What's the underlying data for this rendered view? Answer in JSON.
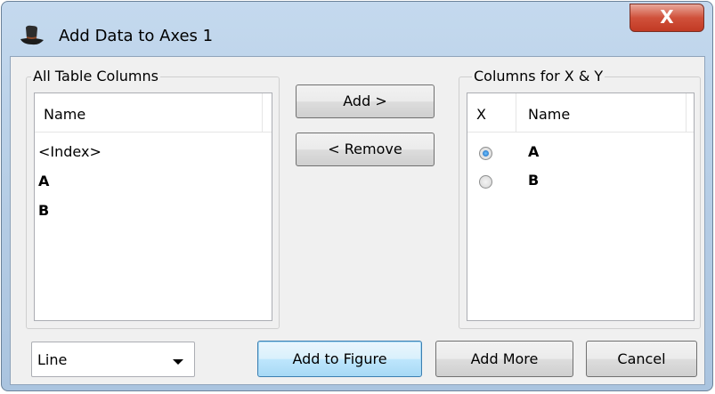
{
  "window": {
    "title": "Add Data to Axes 1",
    "close_glyph": "X",
    "app_icon": "top-hat-icon"
  },
  "all_columns": {
    "group_title": "All Table Columns",
    "header": "Name",
    "items": [
      "<Index>",
      "A",
      "B"
    ]
  },
  "buttons": {
    "add": "Add >",
    "remove": "< Remove",
    "add_to_figure": "Add to Figure",
    "add_more": "Add More",
    "cancel": "Cancel"
  },
  "xy_columns": {
    "group_title": "Columns for X & Y",
    "header_x": "X",
    "header_name": "Name",
    "rows": [
      {
        "name": "A",
        "is_x": true
      },
      {
        "name": "B",
        "is_x": false
      }
    ]
  },
  "plot_type": {
    "selected": "Line"
  },
  "colors": {
    "accent": "#3c7fb1",
    "close": "#c23a24"
  }
}
